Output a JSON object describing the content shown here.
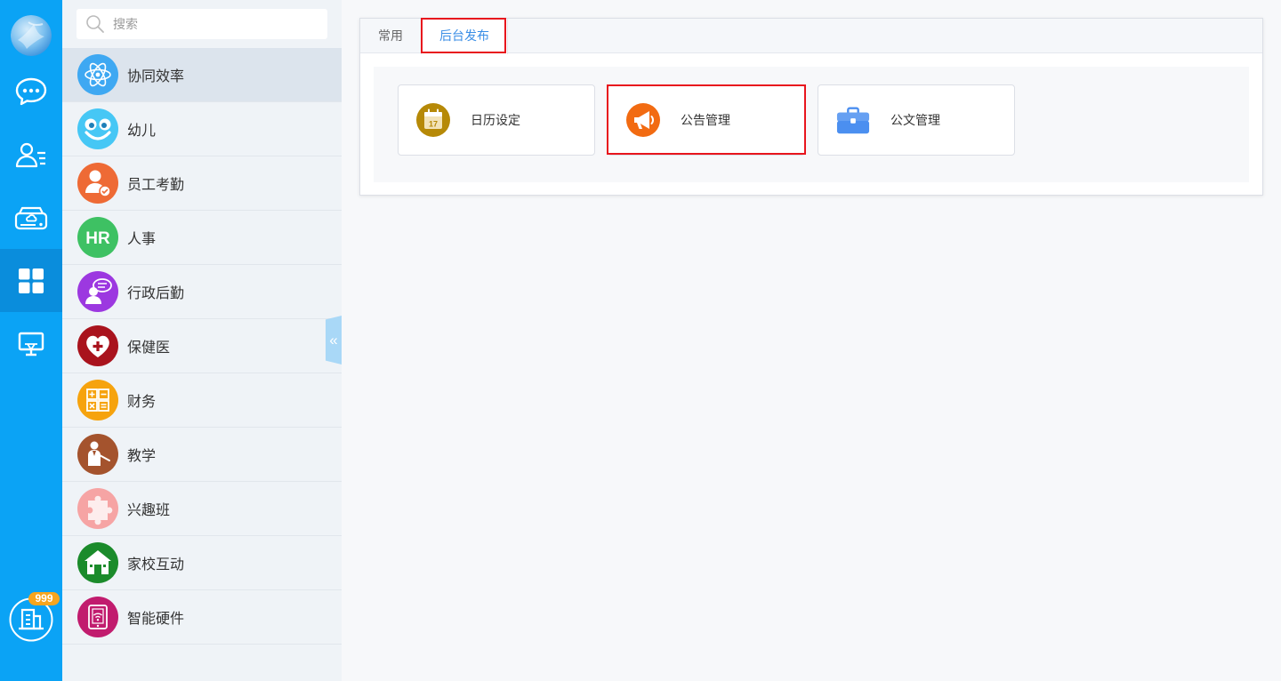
{
  "theme": {
    "rail_bg": "#0ba3f5",
    "rail_active": "#0a8ddc",
    "panel_bg": "#eff3f7",
    "panel_active": "#dce4ed",
    "main_bg": "#f7f8fa",
    "accent": "#3a8ee6",
    "badge": "#f7a51e",
    "annotation": "#e8151d"
  },
  "rail": {
    "avatar": "globe-avatar",
    "items": [
      {
        "icon": "chat-bubble-icon",
        "active": false
      },
      {
        "icon": "contacts-icon",
        "active": false
      },
      {
        "icon": "cloud-drive-icon",
        "active": false
      },
      {
        "icon": "apps-grid-icon",
        "active": true
      },
      {
        "icon": "monitor-icon",
        "active": false
      }
    ],
    "org": {
      "icon": "building-icon",
      "badge": "999"
    }
  },
  "search": {
    "placeholder": "搜索",
    "icon": "search-icon"
  },
  "modules": [
    {
      "label": "协同效率",
      "icon": "atom-icon",
      "color": "#3ea8f2",
      "active": true
    },
    {
      "label": "幼儿",
      "icon": "child-face-icon",
      "color": "#46c7f5",
      "active": false
    },
    {
      "label": "员工考勤",
      "icon": "staff-attendance-icon",
      "color": "#ee6a35",
      "active": false
    },
    {
      "label": "人事",
      "icon": "hr-icon",
      "icon_text": "HR",
      "color": "#3ec163",
      "active": false
    },
    {
      "label": "行政后勤",
      "icon": "admin-logistics-icon",
      "color": "#9c38e0",
      "active": false
    },
    {
      "label": "保健医",
      "icon": "health-heart-icon",
      "color": "#a9131d",
      "active": false
    },
    {
      "label": "财务",
      "icon": "calculator-icon",
      "color": "#f6a30e",
      "active": false
    },
    {
      "label": "教学",
      "icon": "teacher-icon",
      "color": "#a4532d",
      "active": false
    },
    {
      "label": "兴趣班",
      "icon": "puzzle-icon",
      "color": "#f6a4a4",
      "active": false
    },
    {
      "label": "家校互动",
      "icon": "home-school-icon",
      "color": "#1b8b2b",
      "active": false
    },
    {
      "label": "智能硬件",
      "icon": "smart-device-icon",
      "color": "#c11c6e",
      "active": false
    }
  ],
  "collapse": {
    "glyph": "«",
    "icon": "collapse-left-icon"
  },
  "tabs": [
    {
      "label": "常用",
      "active": false
    },
    {
      "label": "后台发布",
      "active": true
    }
  ],
  "tiles": [
    {
      "label": "日历设定",
      "icon": "calendar-icon",
      "icon_text": "17",
      "color": "#b68907"
    },
    {
      "label": "公告管理",
      "icon": "megaphone-icon",
      "color": "#f26b12"
    },
    {
      "label": "公文管理",
      "icon": "briefcase-icon",
      "color": "#4b8ff0"
    }
  ]
}
